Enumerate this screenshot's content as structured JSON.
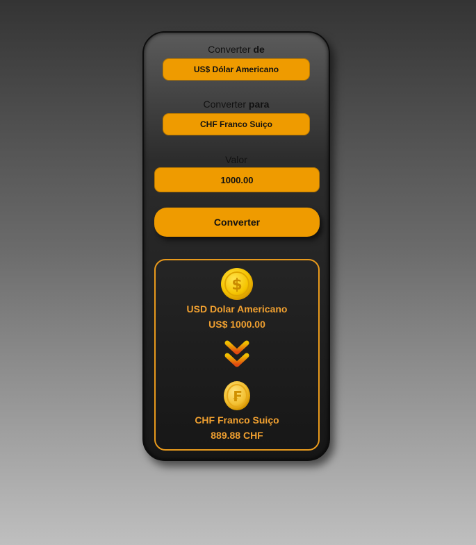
{
  "from": {
    "label_prefix": "Converter",
    "label_strong": "de",
    "selected": "US$ Dólar Americano"
  },
  "to": {
    "label_prefix": "Converter",
    "label_strong": "para",
    "selected": "CHF Franco Suiço"
  },
  "amount": {
    "label": "Valor",
    "value": "1000.00"
  },
  "convert_button": "Converter",
  "result": {
    "source_icon": "dollar-coin-icon",
    "source_name": "USD Dolar Americano",
    "source_amount": "US$ 1000.00",
    "arrow_icon": "double-chevron-down-icon",
    "target_icon": "franc-coin-icon",
    "target_name": "CHF Franco Suiço",
    "target_amount": "889.88 CHF"
  },
  "colors": {
    "accent": "#ef9b00",
    "result_text": "#f0a030",
    "result_border": "#e99a1c"
  }
}
